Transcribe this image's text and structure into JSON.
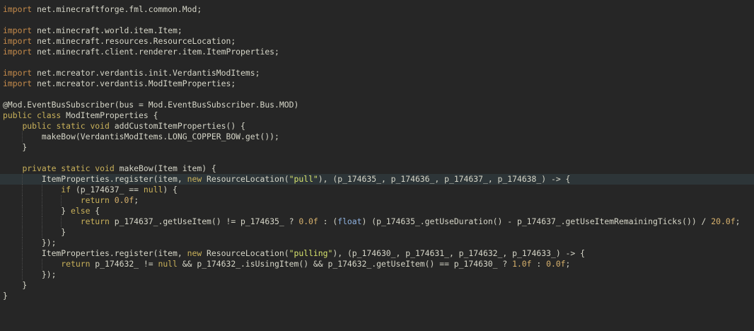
{
  "editor": {
    "lines": [
      {
        "t": [
          [
            "c-import",
            "import"
          ],
          [
            "",
            " net.minecraftforge.fml.common.Mod;"
          ]
        ]
      },
      {
        "t": []
      },
      {
        "t": [
          [
            "c-import",
            "import"
          ],
          [
            "",
            " net.minecraft.world.item.Item;"
          ]
        ]
      },
      {
        "t": [
          [
            "c-import",
            "import"
          ],
          [
            "",
            " net.minecraft.resources.ResourceLocation;"
          ]
        ]
      },
      {
        "t": [
          [
            "c-import",
            "import"
          ],
          [
            "",
            " net.minecraft.client.renderer.item.ItemProperties;"
          ]
        ]
      },
      {
        "t": []
      },
      {
        "t": [
          [
            "c-import",
            "import"
          ],
          [
            "",
            " net.mcreator.verdantis.init.VerdantisModItems;"
          ]
        ]
      },
      {
        "t": [
          [
            "c-import",
            "import"
          ],
          [
            "",
            " net.mcreator.verdantis.ModItemProperties;"
          ]
        ]
      },
      {
        "t": []
      },
      {
        "t": [
          [
            "",
            "@Mod.EventBusSubscriber(bus = Mod.EventBusSubscriber.Bus.MOD)"
          ]
        ]
      },
      {
        "t": [
          [
            "c-kw",
            "public class"
          ],
          [
            "",
            " ModItemProperties {"
          ]
        ]
      },
      {
        "t": [
          [
            "",
            "    "
          ],
          [
            "c-kw",
            "public static void"
          ],
          [
            "",
            " addCustomItemProperties() {"
          ]
        ]
      },
      {
        "t": [
          [
            "",
            "        makeBow(VerdantisModItems.LONG_COPPER_BOW.get());"
          ]
        ]
      },
      {
        "t": [
          [
            "",
            "    }"
          ]
        ]
      },
      {
        "t": []
      },
      {
        "t": [
          [
            "",
            "    "
          ],
          [
            "c-kw",
            "private static void"
          ],
          [
            "",
            " makeBow(Item item) {"
          ]
        ]
      },
      {
        "hl": true,
        "t": [
          [
            "",
            "        ItemProperties.register(item, "
          ],
          [
            "c-kw",
            "new"
          ],
          [
            "",
            " ResourceLocation("
          ],
          [
            "c-str",
            "\"pull\""
          ],
          [
            "",
            "), (p_174635_, p_174636_, p_174637_, p_174638_) -> {"
          ]
        ]
      },
      {
        "t": [
          [
            "",
            "            "
          ],
          [
            "c-kw",
            "if"
          ],
          [
            "",
            " (p_174637_ == "
          ],
          [
            "c-kw",
            "null"
          ],
          [
            "",
            ") {"
          ]
        ]
      },
      {
        "t": [
          [
            "",
            "                "
          ],
          [
            "c-kw",
            "return"
          ],
          [
            "",
            " "
          ],
          [
            "c-num",
            "0.0f"
          ],
          [
            "",
            ";"
          ]
        ]
      },
      {
        "t": [
          [
            "",
            "            } "
          ],
          [
            "c-kw",
            "else"
          ],
          [
            "",
            " {"
          ]
        ]
      },
      {
        "t": [
          [
            "",
            "                "
          ],
          [
            "c-kw",
            "return"
          ],
          [
            "",
            " p_174637_.getUseItem() != p_174635_ ? "
          ],
          [
            "c-num",
            "0.0f"
          ],
          [
            "",
            " : ("
          ],
          [
            "c-float",
            "float"
          ],
          [
            "",
            ") (p_174635_.getUseDuration() - p_174637_.getUseItemRemainingTicks()) / "
          ],
          [
            "c-num",
            "20.0f"
          ],
          [
            "",
            ";"
          ]
        ]
      },
      {
        "t": [
          [
            "",
            "            }"
          ]
        ]
      },
      {
        "t": [
          [
            "",
            "        });"
          ]
        ]
      },
      {
        "t": [
          [
            "",
            "        ItemProperties.register(item, "
          ],
          [
            "c-kw",
            "new"
          ],
          [
            "",
            " ResourceLocation("
          ],
          [
            "c-str",
            "\"pulling\""
          ],
          [
            "",
            "), (p_174630_, p_174631_, p_174632_, p_174633_) -> {"
          ]
        ]
      },
      {
        "t": [
          [
            "",
            "            "
          ],
          [
            "c-kw",
            "return"
          ],
          [
            "",
            " p_174632_ != "
          ],
          [
            "c-kw",
            "null"
          ],
          [
            "",
            " && p_174632_.isUsingItem() && p_174632_.getUseItem() == p_174630_ ? "
          ],
          [
            "c-num",
            "1.0f"
          ],
          [
            "",
            " : "
          ],
          [
            "c-num",
            "0.0f"
          ],
          [
            "",
            ";"
          ]
        ]
      },
      {
        "t": [
          [
            "",
            "        });"
          ]
        ]
      },
      {
        "t": [
          [
            "",
            "    }"
          ]
        ]
      },
      {
        "t": [
          [
            "",
            "}"
          ]
        ]
      }
    ]
  }
}
